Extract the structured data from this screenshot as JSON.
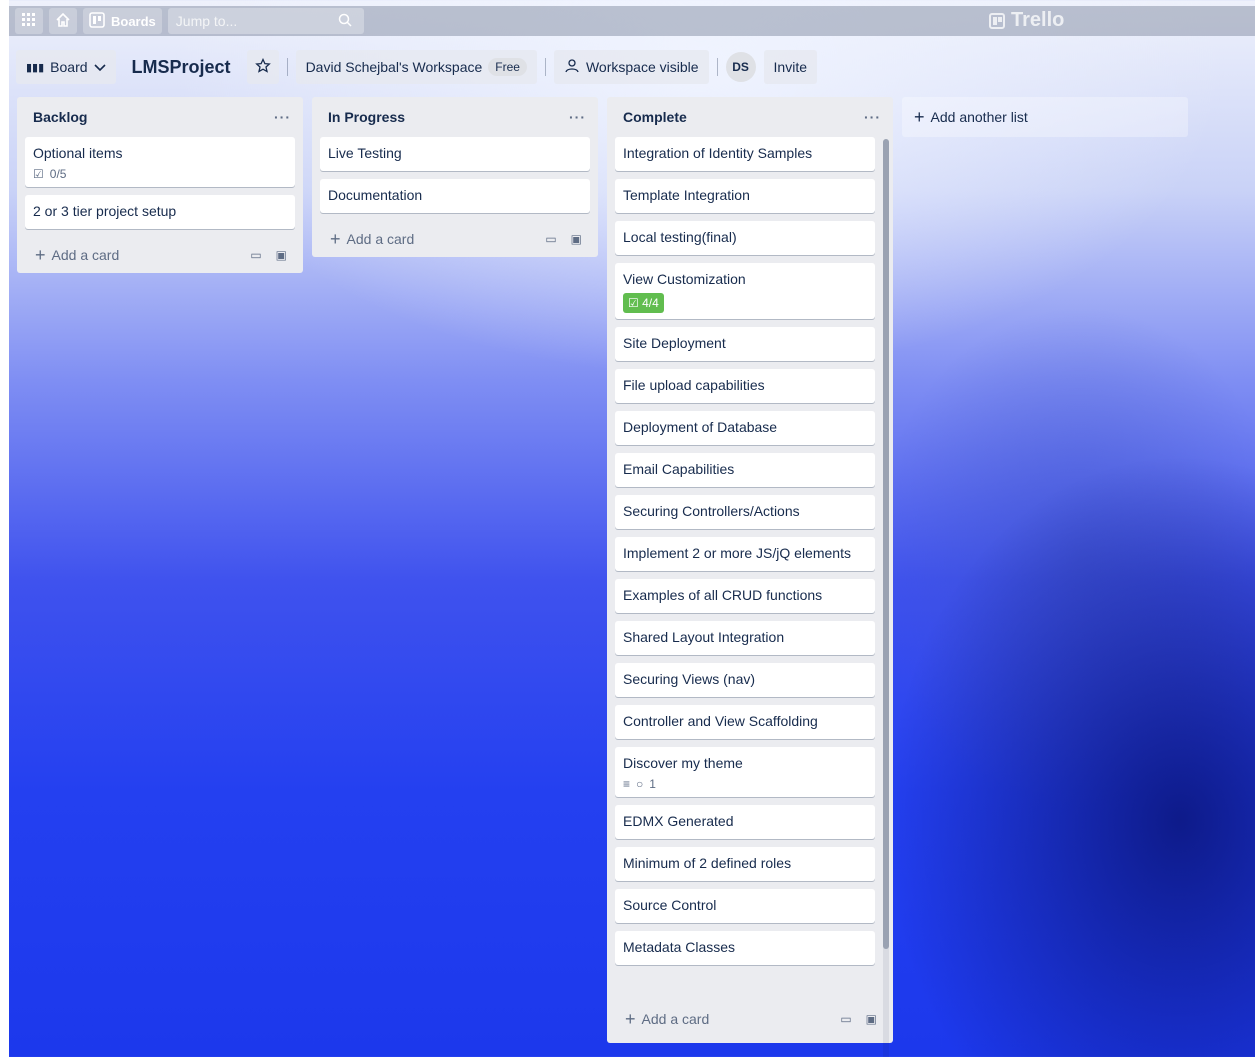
{
  "topbar": {
    "apps_icon": "grid-icon",
    "home_icon": "home-icon",
    "boards_label": "Boards",
    "search_placeholder": "Jump to...",
    "logo_text": "Trello"
  },
  "board": {
    "view_label": "Board",
    "title": "LMSProject",
    "workspace_name": "David Schejbal's Workspace",
    "workspace_badge": "Free",
    "visibility_label": "Workspace visible",
    "member_initials": "DS",
    "invite_label": "Invite"
  },
  "lists": [
    {
      "title": "Backlog",
      "cards": [
        {
          "title": "Optional items",
          "checklist": "0/5"
        },
        {
          "title": "2 or 3 tier project setup"
        }
      ],
      "add_card_label": "Add a card"
    },
    {
      "title": "In Progress",
      "cards": [
        {
          "title": "Live Testing"
        },
        {
          "title": "Documentation"
        }
      ],
      "add_card_label": "Add a card"
    },
    {
      "title": "Complete",
      "cards": [
        {
          "title": "Integration of Identity Samples"
        },
        {
          "title": "Template Integration"
        },
        {
          "title": "Local testing(final)"
        },
        {
          "title": "View Customization",
          "checklist": "4/4",
          "checklist_complete": true
        },
        {
          "title": "Site Deployment"
        },
        {
          "title": "File upload capabilities"
        },
        {
          "title": "Deployment of Database"
        },
        {
          "title": "Email Capabilities"
        },
        {
          "title": "Securing Controllers/Actions"
        },
        {
          "title": "Implement 2 or more JS/jQ elements"
        },
        {
          "title": "Examples of all CRUD functions"
        },
        {
          "title": "Shared Layout Integration"
        },
        {
          "title": "Securing Views (nav)"
        },
        {
          "title": "Controller and View Scaffolding"
        },
        {
          "title": "Discover my theme",
          "has_description": true,
          "comments": "1"
        },
        {
          "title": "EDMX Generated"
        },
        {
          "title": "Minimum of 2 defined roles"
        },
        {
          "title": "Source Control"
        },
        {
          "title": "Metadata Classes"
        }
      ],
      "add_card_label": "Add a card"
    }
  ],
  "add_list_label": "Add another list",
  "colors": {
    "list_bg": "#ebecf0",
    "card_bg": "#ffffff",
    "checklist_complete": "#61bd4f",
    "text": "#172b4d"
  }
}
